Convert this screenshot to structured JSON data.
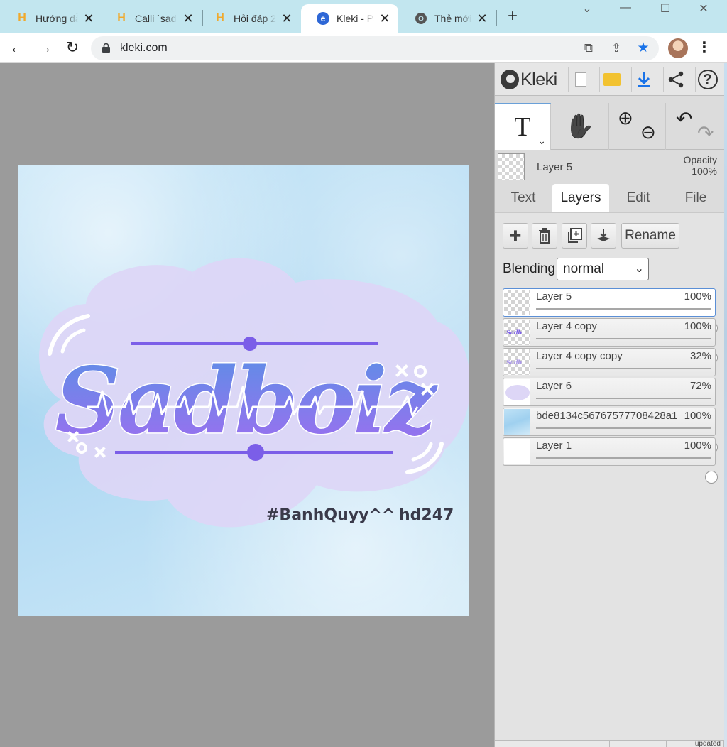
{
  "browser": {
    "tabs": [
      {
        "title": "Hướng dẫn",
        "active": false
      },
      {
        "title": "Calli `sadb",
        "active": false
      },
      {
        "title": "Hỏi đáp 2",
        "active": false
      },
      {
        "title": "Kleki - Pa",
        "active": true
      },
      {
        "title": "Thẻ mới",
        "active": false
      }
    ],
    "close_glyph": "✕",
    "new_tab_glyph": "+",
    "window_controls": {
      "chevron": "⌄",
      "minimize": "—",
      "maximize": "☐",
      "close": "✕"
    },
    "url": "kleki.com",
    "nav": {
      "back": "←",
      "forward": "→",
      "reload": "↻"
    },
    "toolbar_icons": {
      "translate": "⧉",
      "share": "⇪",
      "bookmark": "★",
      "menu": "⋮"
    },
    "accent_color": "#1a73e8"
  },
  "artwork": {
    "lettering": "Sadboiz",
    "credit_left": "#BanhQuyy^^",
    "credit_right": "hd247",
    "colors": {
      "sky": "#b3dbf3",
      "cloud": "#ddd6f6",
      "line": "#7b5ee8",
      "letter_top": "#5b8fe6",
      "letter_bottom": "#9a6cf0"
    }
  },
  "kleki": {
    "brand": "Kleki",
    "top_buttons": {
      "new_icon": "⬜",
      "open_icon": "📂",
      "save_icon": "⬇",
      "share_icon": "share",
      "help_icon": "?"
    },
    "tools": {
      "text_glyph": "T",
      "caret": "⌄",
      "hand_glyph": "✋",
      "zoom_in": "⊕",
      "zoom_out": "⊖",
      "undo": "↶",
      "redo": "↷"
    },
    "current_layer": {
      "name": "Layer 5",
      "opacity_label": "Opacity",
      "opacity_value": "100%"
    },
    "subtabs": [
      "Text",
      "Layers",
      "Edit",
      "File"
    ],
    "active_subtab": "Layers",
    "layer_buttons": {
      "add": "✚",
      "delete": "🗑",
      "duplicate": "⧉",
      "merge": "⤓",
      "rename": "Rename"
    },
    "blending": {
      "label": "Blending",
      "value": "normal",
      "chevron": "⌄"
    },
    "layers": [
      {
        "name": "Layer 5",
        "opacity": "100%",
        "value": 1.0,
        "selected": true,
        "thumb": "checker"
      },
      {
        "name": "Layer 4 copy",
        "opacity": "100%",
        "value": 1.0,
        "selected": false,
        "thumb": "checker"
      },
      {
        "name": "Layer 4 copy copy",
        "opacity": "32%",
        "value": 0.32,
        "selected": false,
        "thumb": "checker"
      },
      {
        "name": "Layer 6",
        "opacity": "72%",
        "value": 0.72,
        "selected": false,
        "thumb": "lavender"
      },
      {
        "name": "bde8134c56767577708428a1",
        "opacity": "100%",
        "value": 1.0,
        "selected": false,
        "thumb": "sky"
      },
      {
        "name": "Layer 1",
        "opacity": "100%",
        "value": 1.0,
        "selected": false,
        "thumb": "white"
      }
    ],
    "status": [
      "",
      "",
      "",
      "updated"
    ]
  }
}
